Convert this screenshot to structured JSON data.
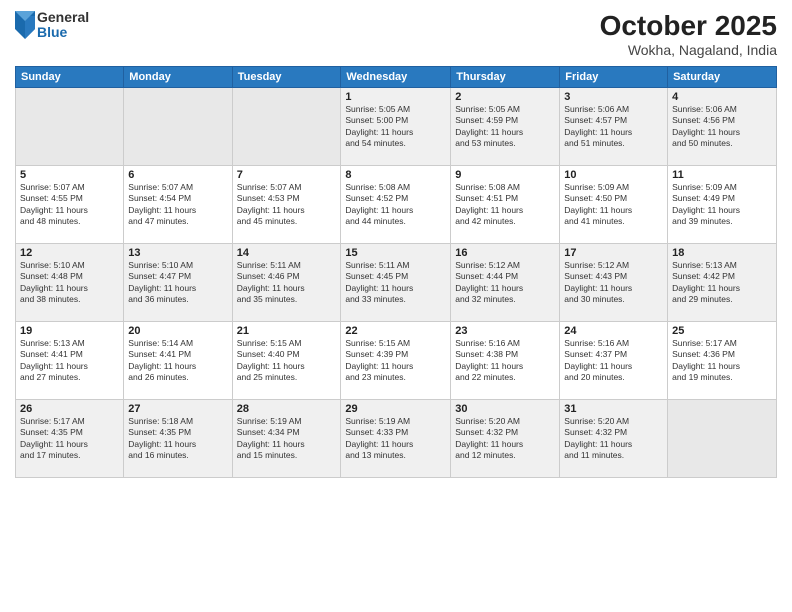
{
  "logo": {
    "general": "General",
    "blue": "Blue"
  },
  "title": "October 2025",
  "location": "Wokha, Nagaland, India",
  "days_header": [
    "Sunday",
    "Monday",
    "Tuesday",
    "Wednesday",
    "Thursday",
    "Friday",
    "Saturday"
  ],
  "weeks": [
    [
      {
        "day": "",
        "info": ""
      },
      {
        "day": "",
        "info": ""
      },
      {
        "day": "",
        "info": ""
      },
      {
        "day": "1",
        "info": "Sunrise: 5:05 AM\nSunset: 5:00 PM\nDaylight: 11 hours\nand 54 minutes."
      },
      {
        "day": "2",
        "info": "Sunrise: 5:05 AM\nSunset: 4:59 PM\nDaylight: 11 hours\nand 53 minutes."
      },
      {
        "day": "3",
        "info": "Sunrise: 5:06 AM\nSunset: 4:57 PM\nDaylight: 11 hours\nand 51 minutes."
      },
      {
        "day": "4",
        "info": "Sunrise: 5:06 AM\nSunset: 4:56 PM\nDaylight: 11 hours\nand 50 minutes."
      }
    ],
    [
      {
        "day": "5",
        "info": "Sunrise: 5:07 AM\nSunset: 4:55 PM\nDaylight: 11 hours\nand 48 minutes."
      },
      {
        "day": "6",
        "info": "Sunrise: 5:07 AM\nSunset: 4:54 PM\nDaylight: 11 hours\nand 47 minutes."
      },
      {
        "day": "7",
        "info": "Sunrise: 5:07 AM\nSunset: 4:53 PM\nDaylight: 11 hours\nand 45 minutes."
      },
      {
        "day": "8",
        "info": "Sunrise: 5:08 AM\nSunset: 4:52 PM\nDaylight: 11 hours\nand 44 minutes."
      },
      {
        "day": "9",
        "info": "Sunrise: 5:08 AM\nSunset: 4:51 PM\nDaylight: 11 hours\nand 42 minutes."
      },
      {
        "day": "10",
        "info": "Sunrise: 5:09 AM\nSunset: 4:50 PM\nDaylight: 11 hours\nand 41 minutes."
      },
      {
        "day": "11",
        "info": "Sunrise: 5:09 AM\nSunset: 4:49 PM\nDaylight: 11 hours\nand 39 minutes."
      }
    ],
    [
      {
        "day": "12",
        "info": "Sunrise: 5:10 AM\nSunset: 4:48 PM\nDaylight: 11 hours\nand 38 minutes."
      },
      {
        "day": "13",
        "info": "Sunrise: 5:10 AM\nSunset: 4:47 PM\nDaylight: 11 hours\nand 36 minutes."
      },
      {
        "day": "14",
        "info": "Sunrise: 5:11 AM\nSunset: 4:46 PM\nDaylight: 11 hours\nand 35 minutes."
      },
      {
        "day": "15",
        "info": "Sunrise: 5:11 AM\nSunset: 4:45 PM\nDaylight: 11 hours\nand 33 minutes."
      },
      {
        "day": "16",
        "info": "Sunrise: 5:12 AM\nSunset: 4:44 PM\nDaylight: 11 hours\nand 32 minutes."
      },
      {
        "day": "17",
        "info": "Sunrise: 5:12 AM\nSunset: 4:43 PM\nDaylight: 11 hours\nand 30 minutes."
      },
      {
        "day": "18",
        "info": "Sunrise: 5:13 AM\nSunset: 4:42 PM\nDaylight: 11 hours\nand 29 minutes."
      }
    ],
    [
      {
        "day": "19",
        "info": "Sunrise: 5:13 AM\nSunset: 4:41 PM\nDaylight: 11 hours\nand 27 minutes."
      },
      {
        "day": "20",
        "info": "Sunrise: 5:14 AM\nSunset: 4:41 PM\nDaylight: 11 hours\nand 26 minutes."
      },
      {
        "day": "21",
        "info": "Sunrise: 5:15 AM\nSunset: 4:40 PM\nDaylight: 11 hours\nand 25 minutes."
      },
      {
        "day": "22",
        "info": "Sunrise: 5:15 AM\nSunset: 4:39 PM\nDaylight: 11 hours\nand 23 minutes."
      },
      {
        "day": "23",
        "info": "Sunrise: 5:16 AM\nSunset: 4:38 PM\nDaylight: 11 hours\nand 22 minutes."
      },
      {
        "day": "24",
        "info": "Sunrise: 5:16 AM\nSunset: 4:37 PM\nDaylight: 11 hours\nand 20 minutes."
      },
      {
        "day": "25",
        "info": "Sunrise: 5:17 AM\nSunset: 4:36 PM\nDaylight: 11 hours\nand 19 minutes."
      }
    ],
    [
      {
        "day": "26",
        "info": "Sunrise: 5:17 AM\nSunset: 4:35 PM\nDaylight: 11 hours\nand 17 minutes."
      },
      {
        "day": "27",
        "info": "Sunrise: 5:18 AM\nSunset: 4:35 PM\nDaylight: 11 hours\nand 16 minutes."
      },
      {
        "day": "28",
        "info": "Sunrise: 5:19 AM\nSunset: 4:34 PM\nDaylight: 11 hours\nand 15 minutes."
      },
      {
        "day": "29",
        "info": "Sunrise: 5:19 AM\nSunset: 4:33 PM\nDaylight: 11 hours\nand 13 minutes."
      },
      {
        "day": "30",
        "info": "Sunrise: 5:20 AM\nSunset: 4:32 PM\nDaylight: 11 hours\nand 12 minutes."
      },
      {
        "day": "31",
        "info": "Sunrise: 5:20 AM\nSunset: 4:32 PM\nDaylight: 11 hours\nand 11 minutes."
      },
      {
        "day": "",
        "info": ""
      }
    ]
  ]
}
